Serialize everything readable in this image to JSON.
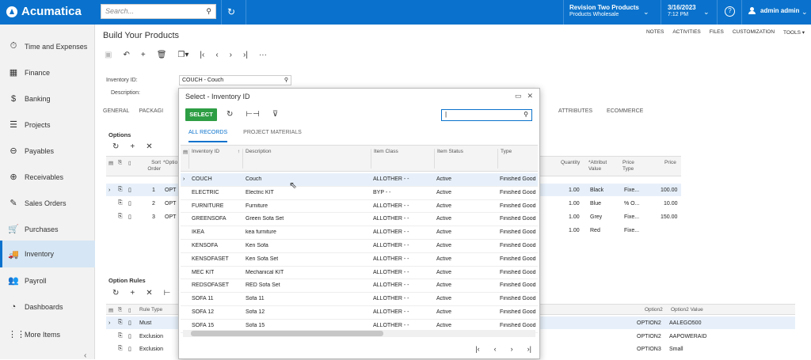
{
  "app": {
    "logo": "Acumatica",
    "search_placeholder": "Search...",
    "branch_line1": "Revision Two Products",
    "branch_line2": "Products Wholesale",
    "date": "3/16/2023",
    "time": "7:12 PM",
    "user": "admin admin"
  },
  "sidebar": {
    "items": [
      {
        "label": "Time and Expenses",
        "icon": "⏱"
      },
      {
        "label": "Finance",
        "icon": "▦"
      },
      {
        "label": "Banking",
        "icon": "$"
      },
      {
        "label": "Projects",
        "icon": "☰"
      },
      {
        "label": "Payables",
        "icon": "⊖"
      },
      {
        "label": "Receivables",
        "icon": "⊕"
      },
      {
        "label": "Sales Orders",
        "icon": "✎"
      },
      {
        "label": "Purchases",
        "icon": "🛒"
      },
      {
        "label": "Inventory",
        "icon": "🚚"
      },
      {
        "label": "Payroll",
        "icon": "👥"
      },
      {
        "label": "Dashboards",
        "icon": "◔"
      },
      {
        "label": "More Items",
        "icon": "⋮⋮"
      }
    ],
    "active": "Inventory"
  },
  "page": {
    "title": "Build Your Products",
    "links": [
      "NOTES",
      "ACTIVITIES",
      "FILES",
      "CUSTOMIZATION",
      "TOOLS ▾"
    ],
    "inventory_label": "Inventory ID:",
    "inventory_value": "COUCH - Couch",
    "description_label": "Description:",
    "tabs": [
      "GENERAL",
      "PACKAGI"
    ],
    "tabs_right": [
      "ATTRIBUTES",
      "ECOMMERCE"
    ]
  },
  "options": {
    "title": "Options",
    "headers": {
      "sort": "Sort Order",
      "opt": "*Optio",
      "qty": "Quantity",
      "attr": "*Attribut Value",
      "ptype": "Price Type",
      "price": "Price"
    },
    "rows": [
      {
        "sort": "1",
        "opt": "OPT",
        "qty": "1.00",
        "attr": "Black",
        "ptype": "Fixe...",
        "price": "100.00"
      },
      {
        "sort": "2",
        "opt": "OPT",
        "qty": "1.00",
        "attr": "Blue",
        "ptype": "% O...",
        "price": "10.00"
      },
      {
        "sort": "3",
        "opt": "OPT",
        "qty": "1.00",
        "attr": "Grey",
        "ptype": "Fixe...",
        "price": "150.00"
      },
      {
        "sort": "",
        "opt": "",
        "qty": "1.00",
        "attr": "Red",
        "ptype": "Fixe...",
        "price": ""
      }
    ]
  },
  "rules": {
    "title": "Option Rules",
    "headers": {
      "rule": "Rule Type",
      "o2": "Option2",
      "o2v": "Option2 Value"
    },
    "rows": [
      {
        "rule": "Must",
        "o2": "OPTION2",
        "o2v": "AALEGO500"
      },
      {
        "rule": "Exclusion",
        "o2": "OPTION2",
        "o2v": "AAPOWERAID"
      },
      {
        "rule": "Exclusion",
        "o2": "OPTION3",
        "o2v": "Small"
      }
    ]
  },
  "modal": {
    "title": "Select - Inventory ID",
    "select_label": "SELECT",
    "search_value": "|",
    "tabs": [
      "ALL RECORDS",
      "PROJECT MATERIALS"
    ],
    "headers": {
      "id": "Inventory ID",
      "desc": "Description",
      "cls": "Item Class",
      "status": "Item Status",
      "type": "Type"
    },
    "rows": [
      {
        "id": "COUCH",
        "desc": "Couch",
        "cls": "ALLOTHER - -",
        "status": "Active",
        "type": "Finished Good"
      },
      {
        "id": "ELECTRIC",
        "desc": "Electric KIT",
        "cls": "BYP - -",
        "status": "Active",
        "type": "Finished Good"
      },
      {
        "id": "FURNITURE",
        "desc": "Furniture",
        "cls": "ALLOTHER - -",
        "status": "Active",
        "type": "Finished Good"
      },
      {
        "id": "GREENSOFA",
        "desc": "Green Sofa Set",
        "cls": "ALLOTHER - -",
        "status": "Active",
        "type": "Finished Good"
      },
      {
        "id": "IKEA",
        "desc": "kea furniture",
        "cls": "ALLOTHER - -",
        "status": "Active",
        "type": "Finished Good"
      },
      {
        "id": "KENSOFA",
        "desc": "Ken Sofa",
        "cls": "ALLOTHER - -",
        "status": "Active",
        "type": "Finished Good"
      },
      {
        "id": "KENSOFASET",
        "desc": "Ken Sofa Set",
        "cls": "ALLOTHER - -",
        "status": "Active",
        "type": "Finished Good"
      },
      {
        "id": "MEC KIT",
        "desc": "Mechanical KIT",
        "cls": "ALLOTHER - -",
        "status": "Active",
        "type": "Finished Good"
      },
      {
        "id": "REDSOFASET",
        "desc": "RED Sofa Set",
        "cls": "ALLOTHER - -",
        "status": "Active",
        "type": "Finished Good"
      },
      {
        "id": "SOFA 11",
        "desc": "Sofa 11",
        "cls": "ALLOTHER - -",
        "status": "Active",
        "type": "Finished Good"
      },
      {
        "id": "SOFA 12",
        "desc": "Sofa 12",
        "cls": "ALLOTHER - -",
        "status": "Active",
        "type": "Finished Good"
      },
      {
        "id": "SOFA 15",
        "desc": "Sofa 15",
        "cls": "ALLOTHER - -",
        "status": "Active",
        "type": "Finished Good"
      }
    ]
  }
}
